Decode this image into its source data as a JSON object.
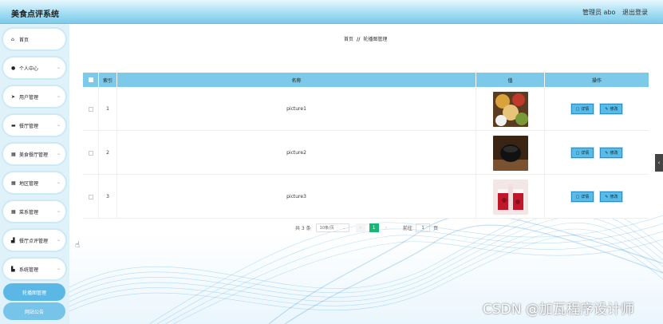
{
  "header": {
    "title": "美食点评系统",
    "user": "管理员 abo",
    "logout": "退出登录"
  },
  "sidebar": {
    "items": [
      {
        "label": "首页",
        "icon": "home-icon",
        "glyph": "⌂",
        "chevron": false
      },
      {
        "label": "个人中心",
        "icon": "user-icon",
        "glyph": "●",
        "chevron": true
      },
      {
        "label": "用户管理",
        "icon": "send-icon",
        "glyph": "➤",
        "chevron": true
      },
      {
        "label": "餐厅管理",
        "icon": "list-icon",
        "glyph": "▬",
        "chevron": true
      },
      {
        "label": "美食餐厅管理",
        "icon": "grid-icon",
        "glyph": "▦",
        "chevron": true
      },
      {
        "label": "地区管理",
        "icon": "grid-icon",
        "glyph": "▦",
        "chevron": true
      },
      {
        "label": "菜系管理",
        "icon": "grid-icon",
        "glyph": "▦",
        "chevron": true
      },
      {
        "label": "餐厅点评管理",
        "icon": "chart-icon",
        "glyph": "▟",
        "chevron": true
      },
      {
        "label": "系统管理",
        "icon": "system-icon",
        "glyph": "▙",
        "chevron": true
      }
    ],
    "sub_items": [
      {
        "label": "轮播图管理"
      },
      {
        "label": "网站公告"
      }
    ]
  },
  "breadcrumb": {
    "home": "首页",
    "sep": "//",
    "current": "轮播图管理"
  },
  "table": {
    "headers": [
      "索引",
      "名称",
      "值",
      "操作"
    ],
    "rows": [
      {
        "index": "1",
        "name": "picture1",
        "thumb": "food-platter"
      },
      {
        "index": "2",
        "name": "picture2",
        "thumb": "dark-bowl"
      },
      {
        "index": "3",
        "name": "picture3",
        "thumb": "red-cake"
      }
    ],
    "detail_label": "详情",
    "edit_label": "修改"
  },
  "pager": {
    "total": "共 3 条",
    "page_size": "10条/页",
    "current_page": "1",
    "goto": "前往",
    "goto_value": "1",
    "page_unit": "页"
  },
  "watermark": "CSDN @加瓦程序设计师",
  "colors": {
    "header_accent": "#7cc9ea",
    "table_header": "#7cc9ea",
    "active_page": "#16b777",
    "button": "#59bce8"
  }
}
